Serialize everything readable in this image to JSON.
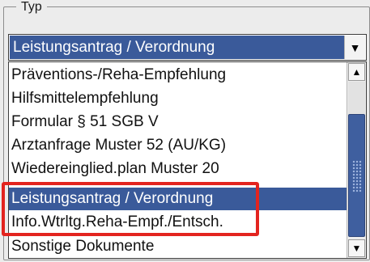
{
  "group": {
    "title": "Typ"
  },
  "combo": {
    "selected_value": "Leistungsantrag / Verordnung",
    "arrow": "▼"
  },
  "list": {
    "items": [
      {
        "label": "Präventions-/Reha-Empfehlung",
        "selected": false
      },
      {
        "label": "Hilfsmittelempfehlung",
        "selected": false
      },
      {
        "label": "Formular § 51 SGB V",
        "selected": false
      },
      {
        "label": "Arztanfrage Muster 52 (AU/KG)",
        "selected": false
      },
      {
        "label": "Wiedereinglied.plan Muster 20",
        "selected": false
      },
      {
        "label": "Leistungsantrag / Verordnung",
        "selected": true
      },
      {
        "label": "Info.Wtrltg.Reha-Empf./Entsch.",
        "selected": false
      },
      {
        "label": "Sonstige Dokumente",
        "selected": false
      }
    ]
  },
  "scrollbar": {
    "up_arrow": "▲",
    "down_arrow": "▼"
  },
  "colors": {
    "selection": "#3a5a9a",
    "highlight": "#e3241f"
  }
}
